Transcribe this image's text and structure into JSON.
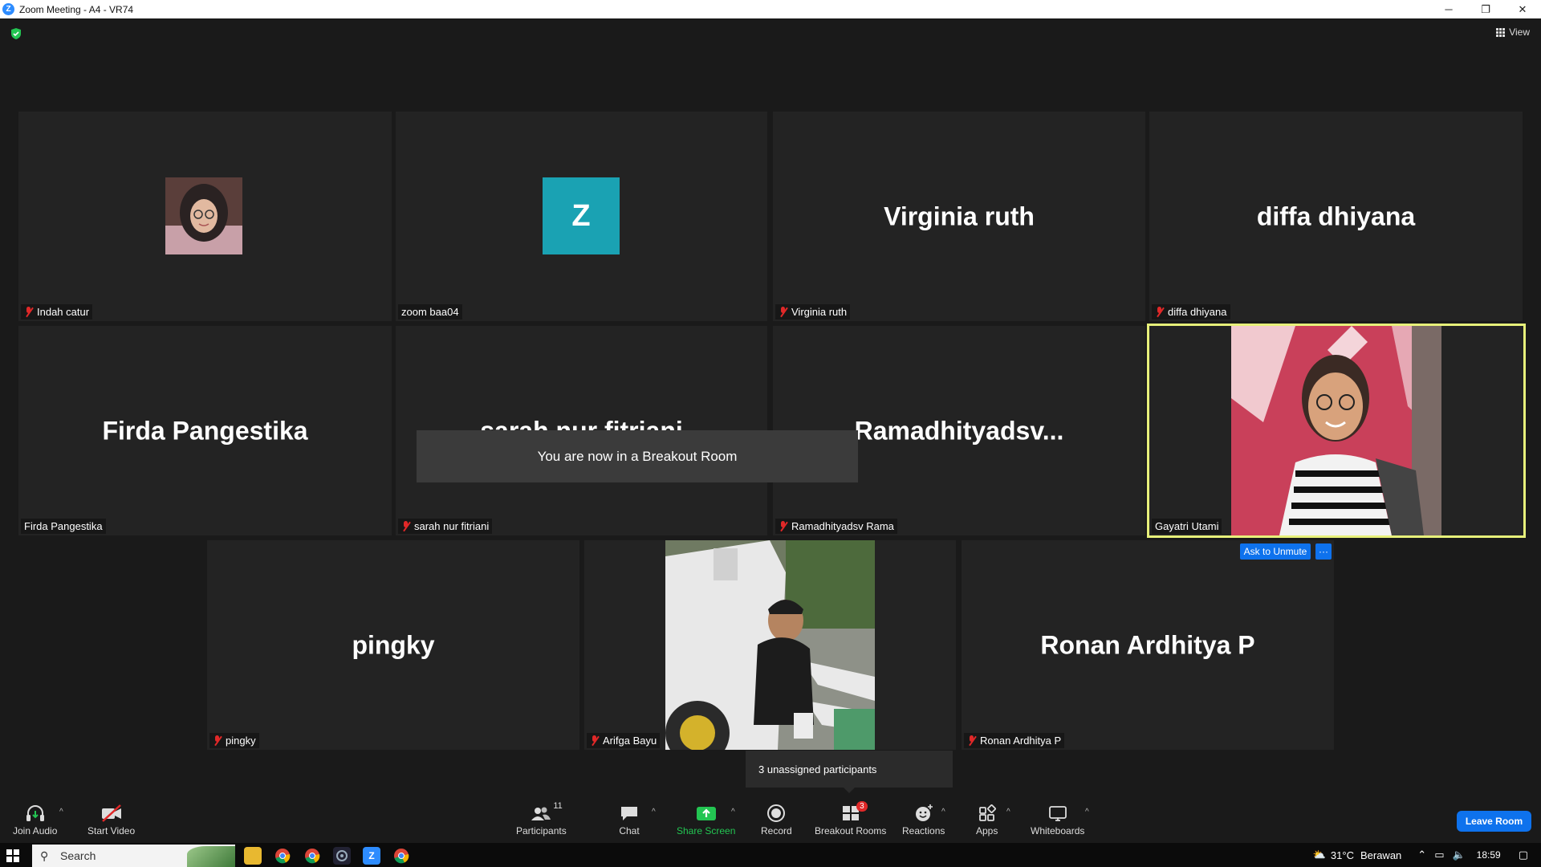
{
  "window": {
    "title": "Zoom Meeting - A4 - VR74",
    "app_letter": "Z",
    "minimize": "─",
    "restore": "❐",
    "close": "✕"
  },
  "view_label": "View",
  "tiles": {
    "t1": {
      "label": "Indah catur"
    },
    "t2": {
      "label": "zoom baa04",
      "initial": "Z"
    },
    "t3": {
      "label": "Virginia ruth",
      "big": "Virginia ruth"
    },
    "t4": {
      "label": "diffa dhiyana",
      "big": "diffa dhiyana"
    },
    "t5": {
      "label": "Firda Pangestika",
      "big": "Firda Pangestika"
    },
    "t6": {
      "label": "sarah nur fitriani",
      "big": "sarah nur fitriani"
    },
    "t7": {
      "label": "Ramadhityadsv Rama",
      "big": "Ramadhityadsv..."
    },
    "t8": {
      "label": "Gayatri Utami"
    },
    "t9": {
      "label": "pingky",
      "big": "pingky"
    },
    "t10": {
      "label": "Arifga Bayu"
    },
    "t11": {
      "label": "Ronan Ardhitya P",
      "big": "Ronan Ardhitya P"
    }
  },
  "toast": "You are now in a Breakout Room",
  "ask_to_unmute": "Ask to Unmute",
  "more": "···",
  "unassigned": "3 unassigned participants",
  "toolbar": {
    "join_audio": "Join Audio",
    "start_video": "Start Video",
    "participants": "Participants",
    "participants_count": "11",
    "chat": "Chat",
    "share_screen": "Share Screen",
    "record": "Record",
    "breakout_rooms": "Breakout Rooms",
    "breakout_badge": "3",
    "reactions": "Reactions",
    "apps": "Apps",
    "whiteboards": "Whiteboards",
    "leave_room": "Leave Room",
    "caret": "^"
  },
  "taskbar": {
    "search": "Search",
    "temperature": "31°C",
    "weather": "Berawan",
    "time": "18:59"
  },
  "colors": {
    "accent_blue": "#0e72ed",
    "mute_red": "#e02828",
    "share_green": "#23c552",
    "active_border": "#e7f07a",
    "avatar_teal": "#1aa2b3"
  }
}
